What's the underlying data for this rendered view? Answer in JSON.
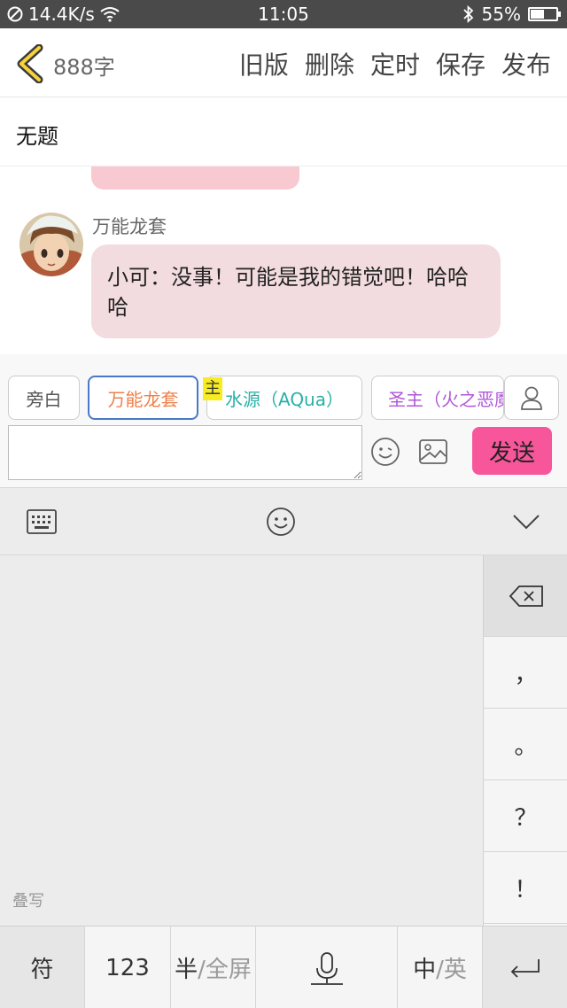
{
  "status_bar": {
    "network_speed": "14.4K/s",
    "time": "11:05",
    "battery_percent": "55%",
    "battery_level": 0.55
  },
  "header": {
    "word_count": "888字",
    "actions": [
      "旧版",
      "删除",
      "定时",
      "保存",
      "发布"
    ]
  },
  "doc_title": "无题",
  "chat": {
    "sender": "万能龙套",
    "message": "小可：没事！可能是我的错觉吧！哈哈哈"
  },
  "roles": {
    "narrator": "旁白",
    "wanneng": "万能龙套",
    "main_badge": "主",
    "aqua": "水源（AQua）",
    "shengzhu": "圣主（火之恶魔）"
  },
  "compose": {
    "input_value": "",
    "send_label": "发送"
  },
  "keyboard": {
    "stack_label": "叠写",
    "side_keys": [
      "，",
      "。",
      "？",
      "！"
    ],
    "bottom_keys": {
      "symbols": "符",
      "numbers": "123",
      "half": "半",
      "full": "/全屏",
      "chinese": "中",
      "english": "/英"
    }
  },
  "colors": {
    "accent_pink": "#f7569a",
    "bubble": "#f3dcdf",
    "aqua_role": "#2ab0a8",
    "wanneng_role": "#f0804a",
    "shengzhu_role": "#b057d8",
    "main_badge": "#f7ec22"
  }
}
